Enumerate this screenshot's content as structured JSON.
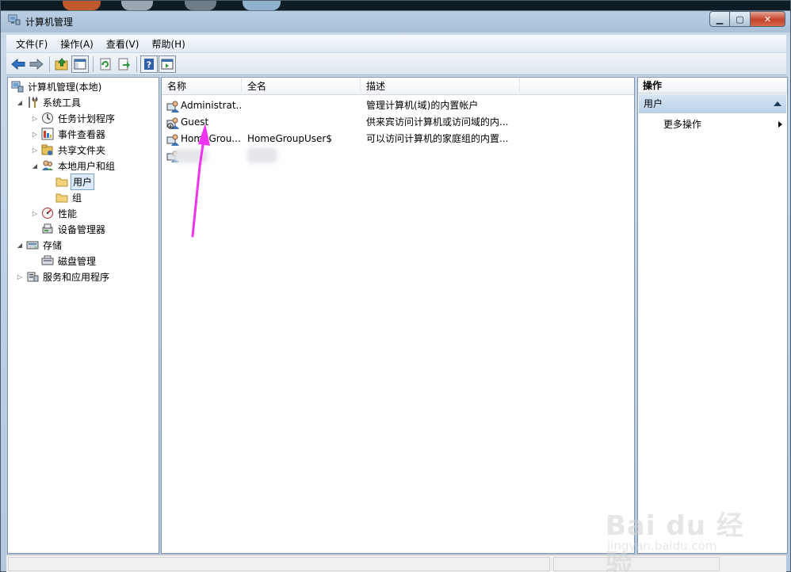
{
  "window": {
    "title": "计算机管理",
    "controls": {
      "minimize": "▁",
      "maximize": "▢",
      "close": "✕"
    }
  },
  "menubar": {
    "items": [
      "文件(F)",
      "操作(A)",
      "查看(V)",
      "帮助(H)"
    ]
  },
  "toolbar": {
    "buttons": [
      "back-icon",
      "forward-icon",
      "up-folder-icon",
      "show-hide-console-tree-icon",
      "refresh-icon",
      "export-list-icon",
      "help-icon",
      "show-hide-action-pane-icon"
    ]
  },
  "tree": {
    "items": [
      {
        "label": "计算机管理(本地)",
        "icon": "computer-management-icon",
        "twisty": ""
      },
      {
        "label": "系统工具",
        "icon": "system-tools-icon",
        "twisty": "◢"
      },
      {
        "label": "任务计划程序",
        "icon": "task-scheduler-icon",
        "twisty": "▷"
      },
      {
        "label": "事件查看器",
        "icon": "event-viewer-icon",
        "twisty": "▷"
      },
      {
        "label": "共享文件夹",
        "icon": "shared-folders-icon",
        "twisty": "▷"
      },
      {
        "label": "本地用户和组",
        "icon": "local-users-icon",
        "twisty": "◢"
      },
      {
        "label": "用户",
        "icon": "folder-icon",
        "twisty": ""
      },
      {
        "label": "组",
        "icon": "folder-icon",
        "twisty": ""
      },
      {
        "label": "性能",
        "icon": "performance-icon",
        "twisty": "▷"
      },
      {
        "label": "设备管理器",
        "icon": "device-manager-icon",
        "twisty": ""
      },
      {
        "label": "存储",
        "icon": "storage-icon",
        "twisty": "◢"
      },
      {
        "label": "磁盘管理",
        "icon": "disk-management-icon",
        "twisty": ""
      },
      {
        "label": "服务和应用程序",
        "icon": "services-apps-icon",
        "twisty": "▷"
      }
    ],
    "selected": "用户"
  },
  "list": {
    "columns": [
      "名称",
      "全名",
      "描述"
    ],
    "rows": [
      {
        "name": "Administrat...",
        "fullname": "",
        "description": "管理计算机(域)的内置帐户"
      },
      {
        "name": "Guest",
        "fullname": "",
        "description": "供来宾访问计算机或访问域的内..."
      },
      {
        "name": "HomeGrou...",
        "fullname": "HomeGroupUser$",
        "description": "可以访问计算机的家庭组的内置..."
      },
      {
        "name": "",
        "fullname": "",
        "description": ""
      }
    ]
  },
  "actions": {
    "header": "操作",
    "section": "用户",
    "item": "更多操作"
  },
  "watermark": {
    "brand": "Bai du 经验",
    "url": "jingyan.baidu.com"
  },
  "colors": {
    "annotation_arrow": "#ee33ee",
    "selection": "#dcebfc",
    "action_section": "#c4d8ee"
  }
}
